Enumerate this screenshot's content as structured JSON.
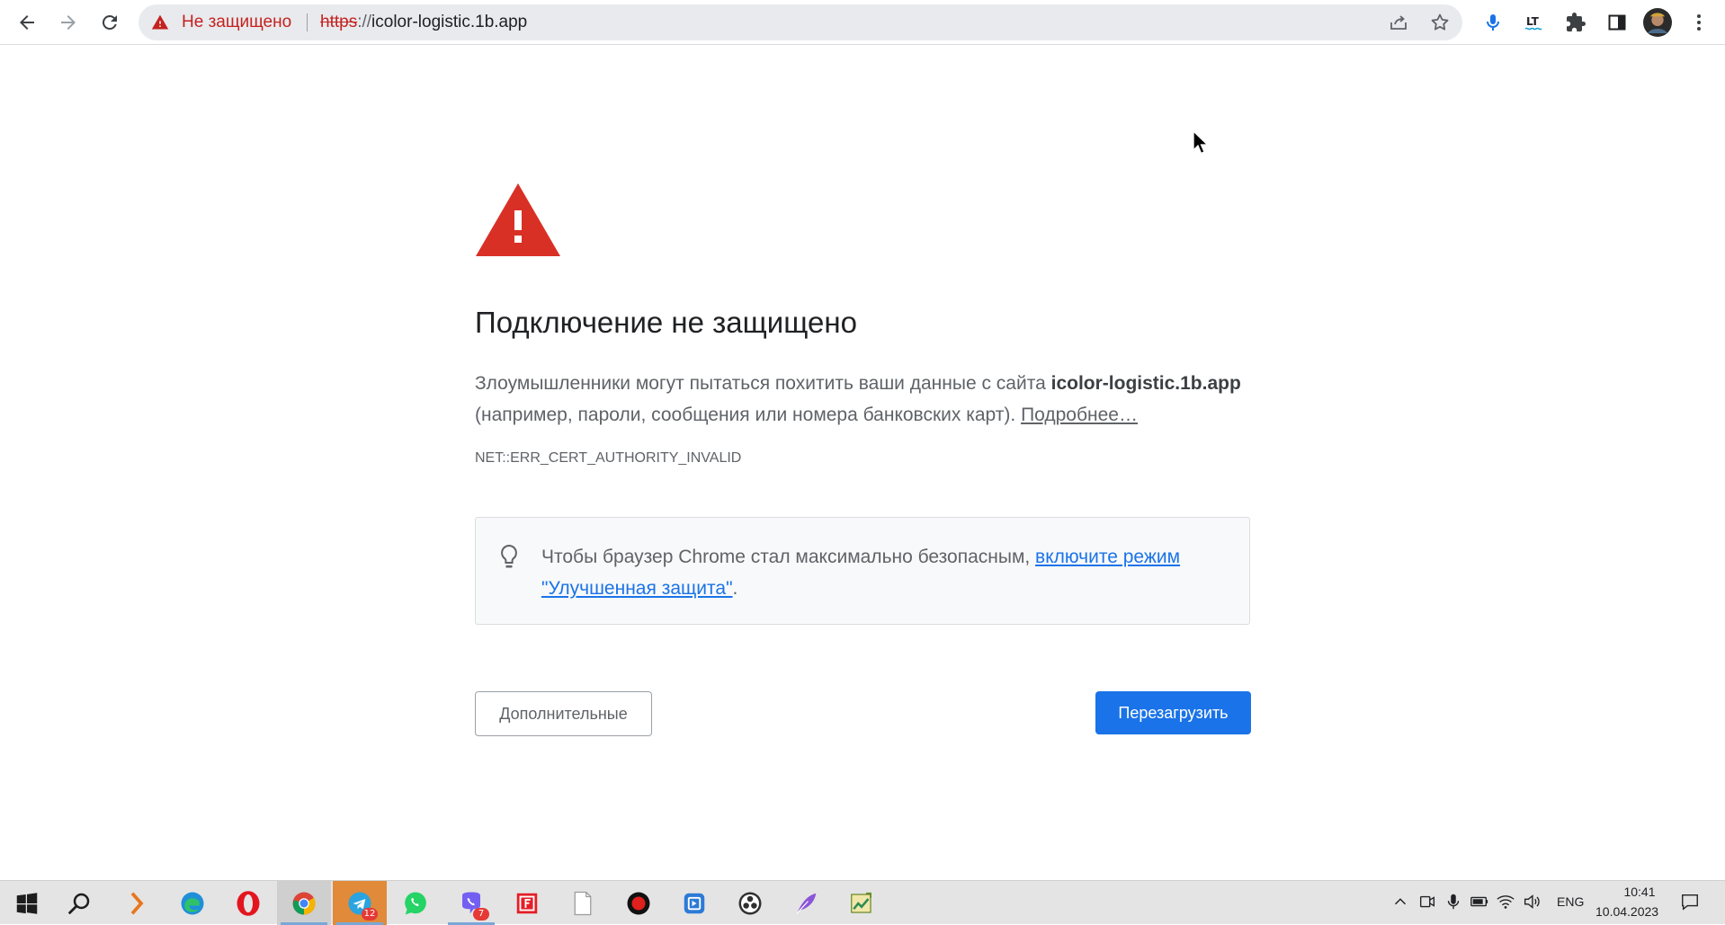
{
  "browser": {
    "security_label": "Не защищено",
    "url_scheme": "https",
    "url_separator": "://",
    "url_host": "icolor-logistic.1b.app",
    "toolbar_icons": [
      "back-arrow-icon",
      "forward-arrow-icon",
      "reload-icon",
      "share-icon",
      "star-icon",
      "microphone-icon",
      "lt-extension-icon",
      "puzzle-extensions-icon",
      "side-panel-icon",
      "profile-avatar",
      "more-vert-icon"
    ],
    "lt_label": "LT"
  },
  "interstitial": {
    "heading": "Подключение не защищено",
    "message_prefix": "Злоумышленники могут пытаться похитить ваши данные с сайта ",
    "message_host": "icolor-logistic.1b.app",
    "message_suffix": " (например, пароли, сообщения или номера банковских карт). ",
    "learn_more": "Подробнее…",
    "error_code": "NET::ERR_CERT_AUTHORITY_INVALID",
    "promo_prefix": "Чтобы браузер Chrome стал максимально безопасным, ",
    "promo_link": "включите режим \"Улучшенная защита\"",
    "promo_suffix": ".",
    "details_button": "Дополнительные",
    "reload_button": "Перезагрузить",
    "colors": {
      "primary": "#1a73e8",
      "warning": "#d93025",
      "danger_text": "#c5221f"
    }
  },
  "taskbar": {
    "apps": [
      "windows-start-icon",
      "search-icon",
      "arrow-app-icon",
      "edge-icon",
      "opera-icon",
      "chrome-icon",
      "telegram-icon",
      "whatsapp-icon",
      "viber-icon",
      "filmora-icon",
      "notepad-file-icon",
      "record-icon",
      "video-editor-icon",
      "obs-icon",
      "feather-icon",
      "chart-app-icon"
    ],
    "telegram_badge": "12",
    "viber_badge": "7",
    "tray": {
      "language": "ENG",
      "time": "10:41",
      "date": "10.04.2023"
    }
  }
}
